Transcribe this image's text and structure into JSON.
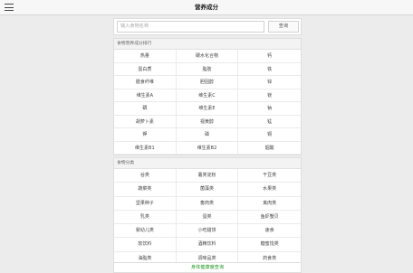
{
  "header": {
    "title": "营养成分",
    "menu_icon": "menu-icon"
  },
  "search": {
    "placeholder": "输入食物名称",
    "button": "查询"
  },
  "section1": {
    "title": "食物营养成分排行",
    "items": [
      "热量",
      "碳水化合物",
      "钙",
      "蛋白质",
      "脂肪",
      "铁",
      "膳食纤维",
      "胆固醇",
      "锌",
      "维生素A",
      "维生素C",
      "镁",
      "硒",
      "维生素E",
      "钠",
      "胡萝卜素",
      "视黄醇",
      "锰",
      "钾",
      "磷",
      "铜",
      "维生素B1",
      "维生素B2",
      "烟酸"
    ]
  },
  "section2": {
    "title": "食物分类",
    "items": [
      "谷类",
      "薯类淀粉",
      "干豆类",
      "蔬菜类",
      "菌藻类",
      "水果类",
      "坚果种子",
      "畜肉类",
      "禽肉类",
      "乳类",
      "蛋类",
      "鱼虾蟹贝",
      "婴幼儿类",
      "小吃甜饼",
      "速食",
      "软饮料",
      "酒精饮料",
      "糖蜜饯类",
      "油脂类",
      "调味品类",
      "药食类"
    ]
  },
  "footer": {
    "link": "身体健康度查询"
  }
}
